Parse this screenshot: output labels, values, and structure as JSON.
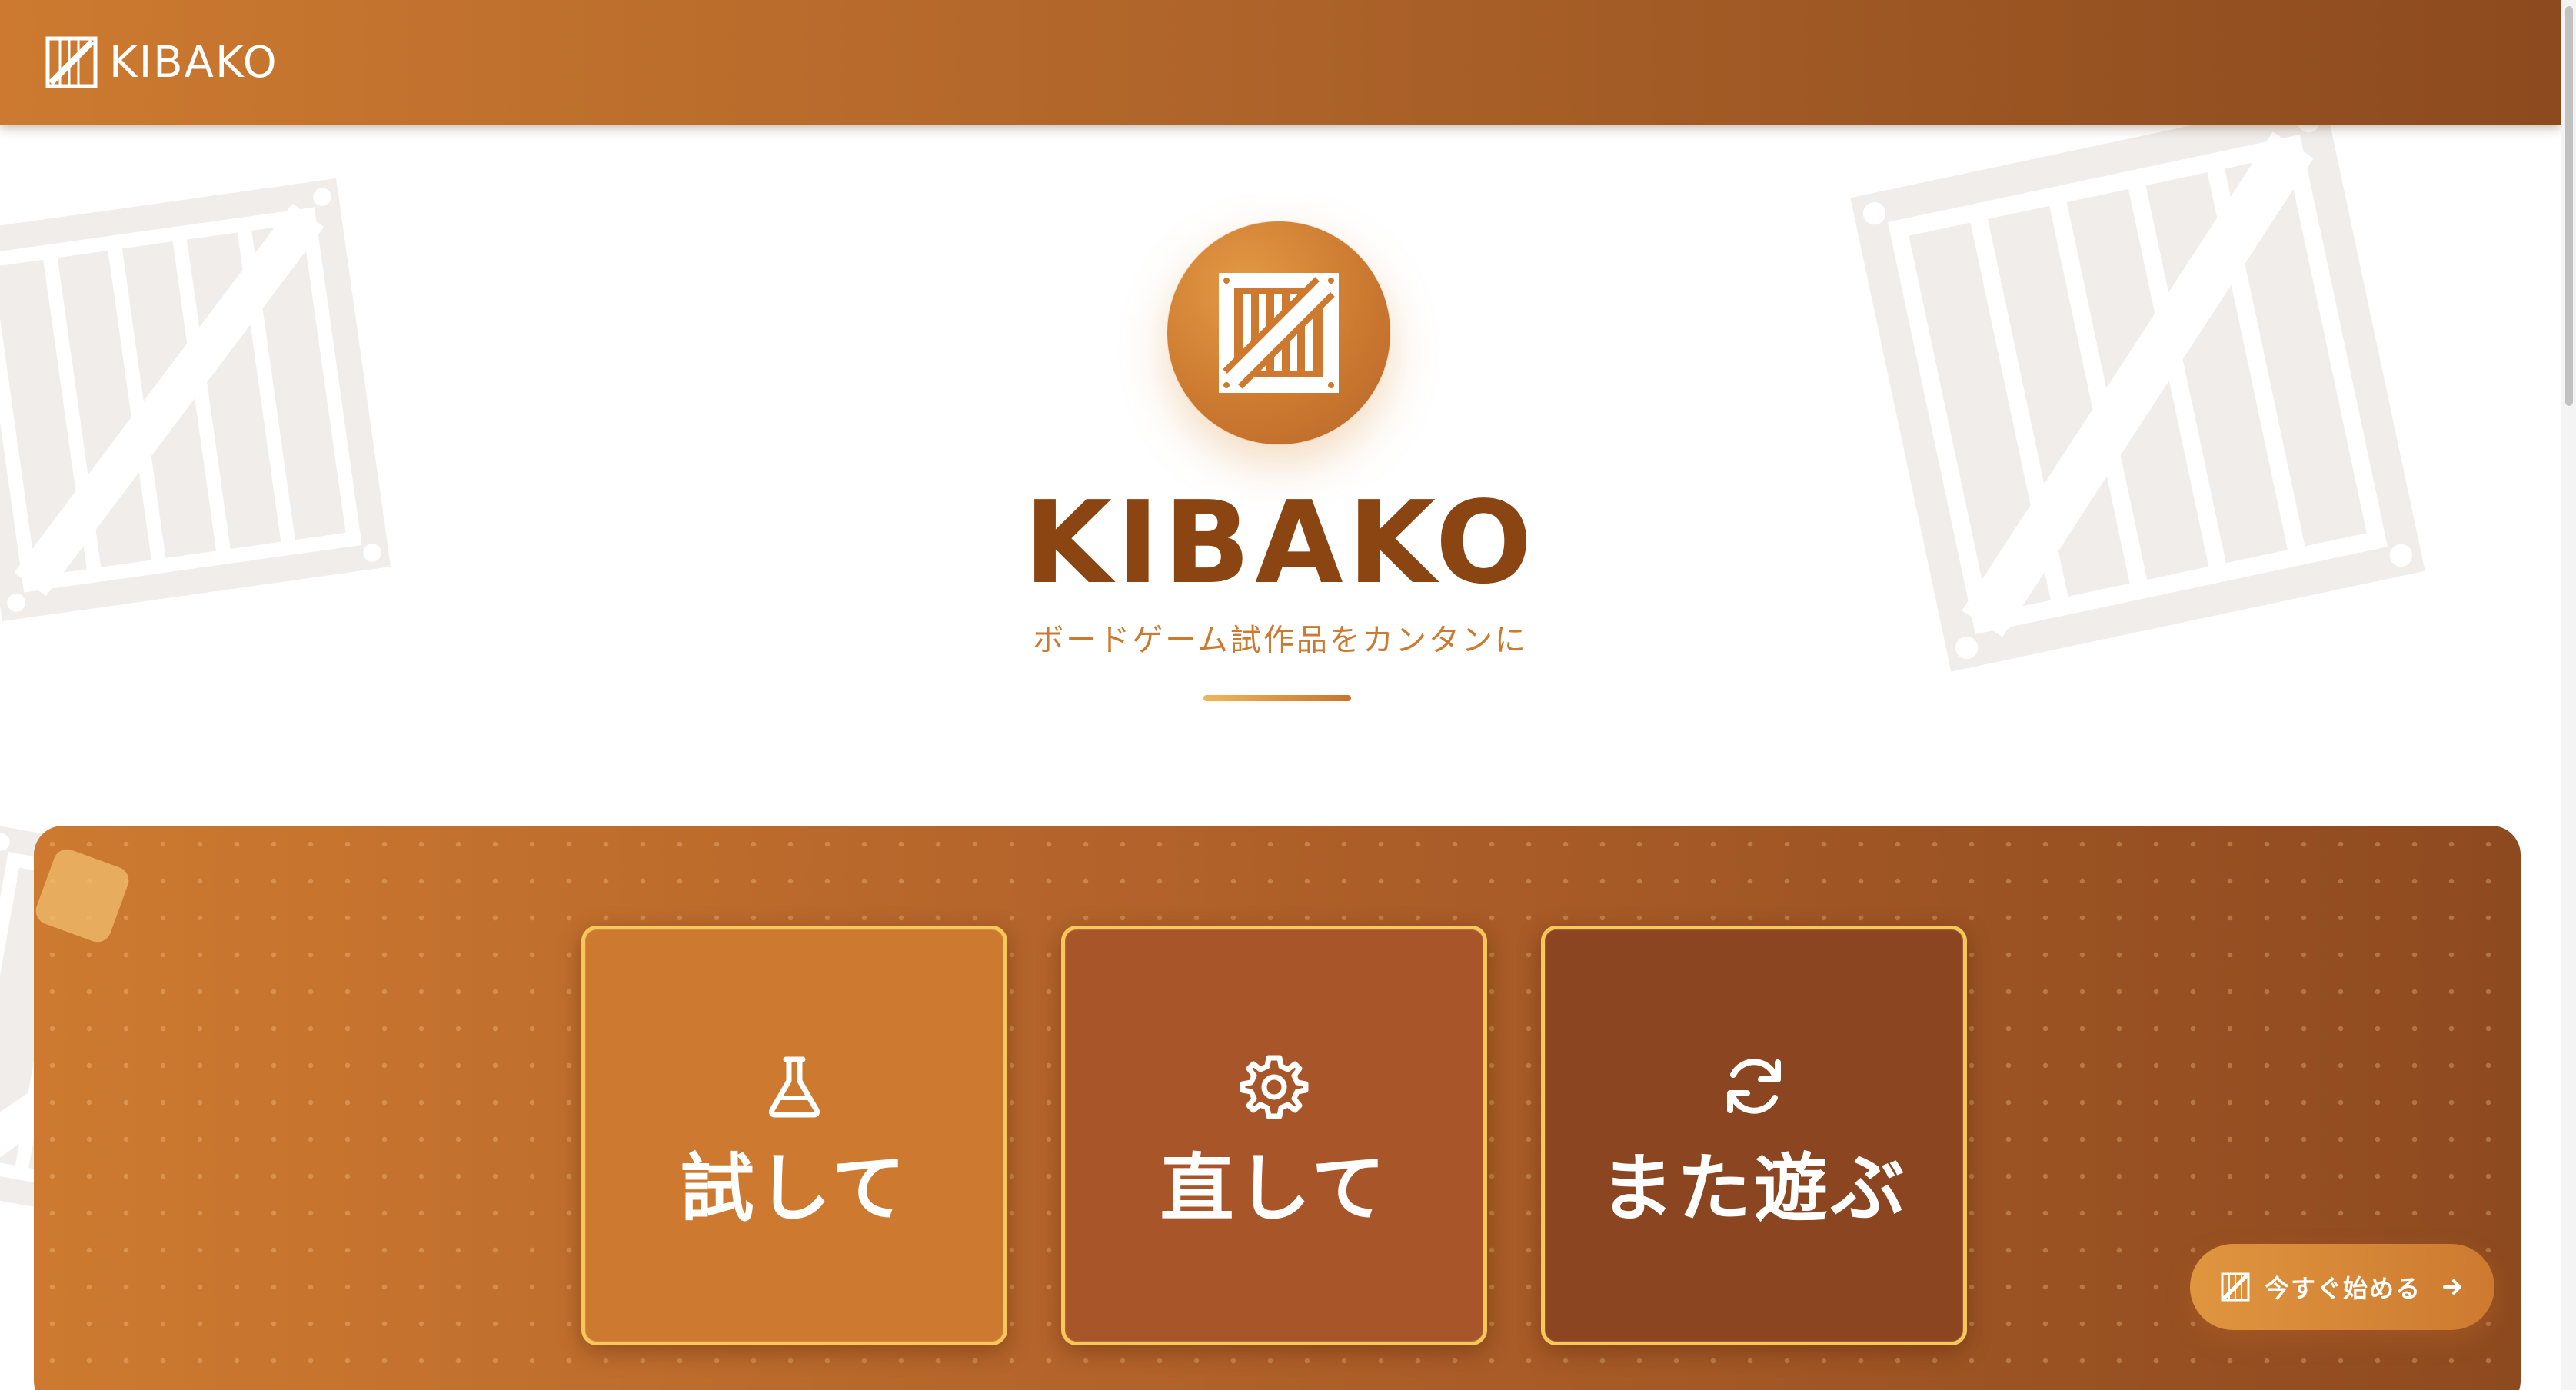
{
  "header": {
    "brand": "KIBAKO",
    "logo_icon": "crate-icon"
  },
  "hero": {
    "title": "KIBAKO",
    "subtitle": "ボードゲーム試作品をカンタンに",
    "logo_icon": "crate-icon"
  },
  "features": [
    {
      "label": "試して",
      "icon": "flask-icon",
      "color": "#cd7a30"
    },
    {
      "label": "直して",
      "icon": "gear-icon",
      "color": "#a9552a"
    },
    {
      "label": "また遊ぶ",
      "icon": "refresh-icon",
      "color": "#8b4520"
    }
  ],
  "cta": {
    "label": "今すぐ始める",
    "icon": "crate-icon",
    "arrow_icon": "arrow-right-icon"
  },
  "theme": {
    "accent": "#cd7a30",
    "dark": "#8b4513",
    "highlight": "#f6c85a"
  }
}
